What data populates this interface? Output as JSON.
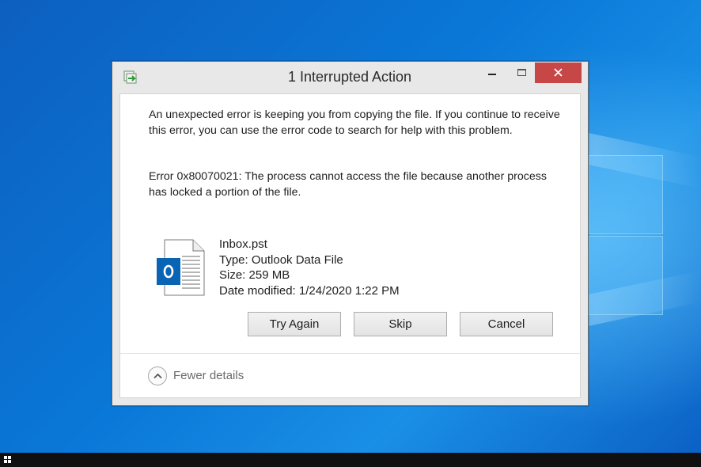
{
  "window": {
    "title": "1 Interrupted Action",
    "close_color": "#c74646"
  },
  "message": {
    "line1": "An unexpected error is keeping you from copying the file. If you continue to receive this error, you can use the error code to search for help with this problem.",
    "line2": "Error 0x80070021: The process cannot access the file because another process has locked a portion of the file."
  },
  "file": {
    "name": "Inbox.pst",
    "type": "Type: Outlook Data File",
    "size": "Size: 259 MB",
    "date_modified": "Date modified: 1/24/2020 1:22 PM",
    "icon": "outlook-pst-icon"
  },
  "buttons": {
    "try_again": "Try Again",
    "skip": "Skip",
    "cancel": "Cancel"
  },
  "details": {
    "label": "Fewer details"
  }
}
